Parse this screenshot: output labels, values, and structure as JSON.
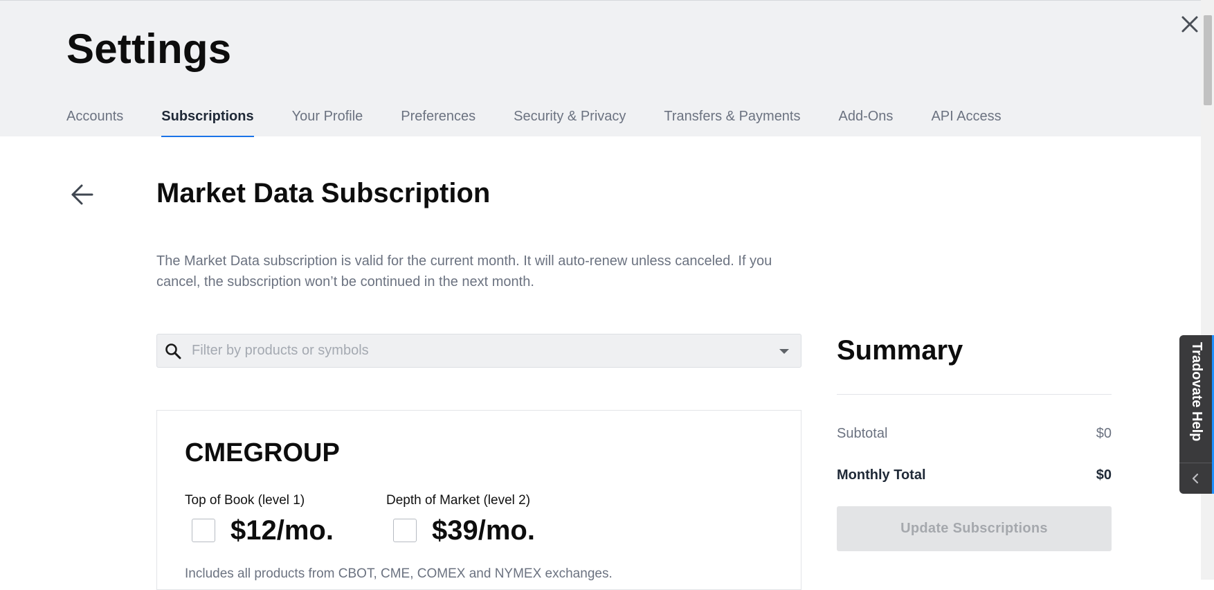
{
  "page": {
    "title": "Settings"
  },
  "tabs": [
    {
      "label": "Accounts",
      "active": false
    },
    {
      "label": "Subscriptions",
      "active": true
    },
    {
      "label": "Your Profile",
      "active": false
    },
    {
      "label": "Preferences",
      "active": false
    },
    {
      "label": "Security & Privacy",
      "active": false
    },
    {
      "label": "Transfers & Payments",
      "active": false
    },
    {
      "label": "Add-Ons",
      "active": false
    },
    {
      "label": "API Access",
      "active": false
    }
  ],
  "section": {
    "title": "Market Data Subscription",
    "description": "The Market Data subscription is valid for the current month. It will auto-renew unless canceled. If you cancel, the subscription won’t be continued in the next month."
  },
  "filter": {
    "placeholder": "Filter by products or symbols",
    "value": ""
  },
  "exchange": {
    "name": "CMEGROUP",
    "tiers": [
      {
        "label": "Top of Book (level 1)",
        "price": "$12/mo.",
        "checked": false
      },
      {
        "label": "Depth of Market (level 2)",
        "price": "$39/mo.",
        "checked": false
      }
    ],
    "includes": "Includes all products from CBOT, CME, COMEX and NYMEX exchanges."
  },
  "summary": {
    "title": "Summary",
    "subtotal_label": "Subtotal",
    "subtotal_value": "$0",
    "total_label": "Monthly Total",
    "total_value": "$0",
    "update_button": "Update Subscriptions"
  },
  "help": {
    "label": "Tradovate Help"
  },
  "icons": {
    "close": "close-icon",
    "back": "arrow-left-icon",
    "search": "search-icon",
    "dropdown": "caret-down-icon",
    "help_collapse": "chevron-left-icon"
  },
  "colors": {
    "accent": "#1a73e8",
    "header_bg": "#f0f1f3",
    "help_tab_bg": "#3a3a3c"
  }
}
